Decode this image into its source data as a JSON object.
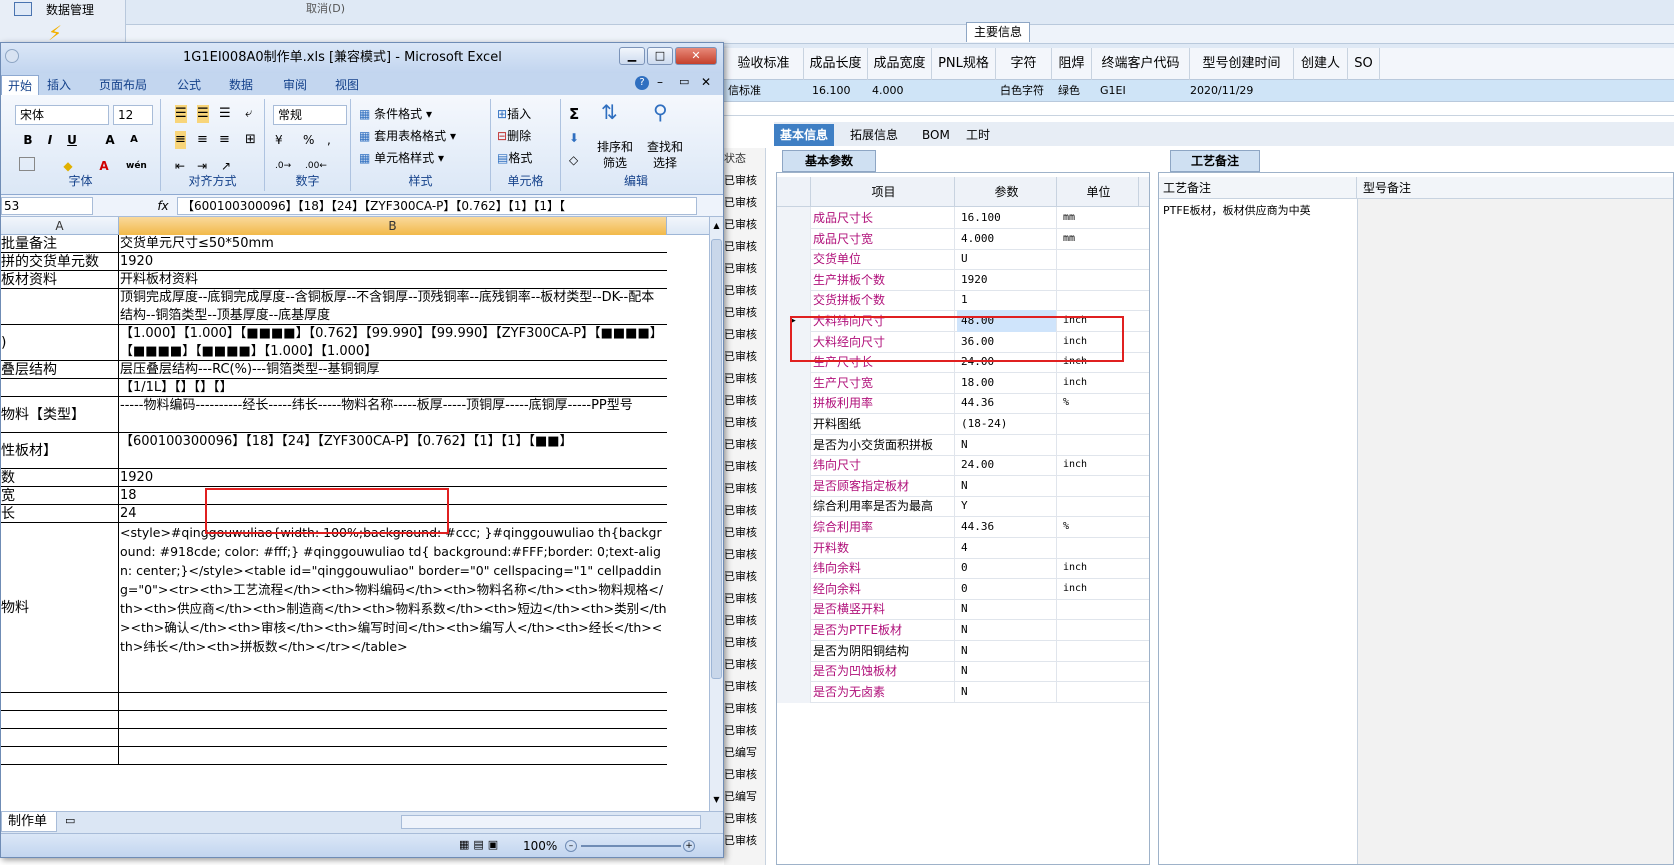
{
  "bg": {
    "nav_item": "数据管理",
    "top_fragment": "取消(D)",
    "main_info_label": "主要信息",
    "grid_headers": [
      "验收标准",
      "成品长度",
      "成品宽度",
      "PNL规格",
      "字符",
      "阻焊",
      "终端客户代码",
      "型号创建时间",
      "创建人",
      "SO"
    ],
    "grid_row": {
      "standard": "信标准",
      "length": "16.100",
      "width": "4.000",
      "char": "白色字符",
      "mask": "绿色",
      "customer": "G1EI",
      "created": "2020/11/29"
    },
    "status_header": "状态",
    "status_cells": [
      "已审核",
      "已审核",
      "已审核",
      "已审核",
      "已审核",
      "已审核",
      "已审核",
      "已审核",
      "已审核",
      "已审核",
      "已审核",
      "已审核",
      "已审核",
      "已审核",
      "已审核",
      "已审核",
      "已审核",
      "已审核",
      "已审核",
      "已审核",
      "已审核",
      "已审核",
      "已审核",
      "已审核",
      "已审核",
      "已审核",
      "已编写",
      "已审核",
      "已编写",
      "已审核",
      "已审核"
    ],
    "tabs": [
      "基本信息",
      "拓展信息",
      "BOM",
      "工时"
    ],
    "subtab_params": "基本参数",
    "subtab_notes": "工艺备注",
    "param_headers": {
      "item": "项目",
      "param": "参数",
      "unit": "单位"
    },
    "params": [
      {
        "name": "成品尺寸长",
        "value": "16.100",
        "unit": "mm",
        "magenta": true
      },
      {
        "name": "成品尺寸宽",
        "value": "4.000",
        "unit": "mm",
        "magenta": true
      },
      {
        "name": "交货单位",
        "value": "U",
        "unit": "",
        "magenta": true
      },
      {
        "name": "生产拼板个数",
        "value": "1920",
        "unit": "",
        "magenta": true
      },
      {
        "name": "交货拼板个数",
        "value": "1",
        "unit": "",
        "magenta": true
      },
      {
        "name": "大料纬向尺寸",
        "value": "48.00",
        "unit": "inch",
        "magenta": true
      },
      {
        "name": "大料经向尺寸",
        "value": "36.00",
        "unit": "inch",
        "magenta": true
      },
      {
        "name": "生产尺寸长",
        "value": "24.00",
        "unit": "inch",
        "magenta": true
      },
      {
        "name": "生产尺寸宽",
        "value": "18.00",
        "unit": "inch",
        "magenta": true
      },
      {
        "name": "拼板利用率",
        "value": "44.36",
        "unit": "%",
        "magenta": true
      },
      {
        "name": "开料图纸",
        "value": "(18-24)",
        "unit": "",
        "magenta": false
      },
      {
        "name": "是否为小交货面积拼板",
        "value": "N",
        "unit": "",
        "magenta": false
      },
      {
        "name": "纬向尺寸",
        "value": "24.00",
        "unit": "inch",
        "magenta": true
      },
      {
        "name": "是否顾客指定板材",
        "value": "N",
        "unit": "",
        "magenta": true
      },
      {
        "name": "综合利用率是否为最高",
        "value": "Y",
        "unit": "",
        "magenta": false
      },
      {
        "name": "综合利用率",
        "value": "44.36",
        "unit": "%",
        "magenta": true
      },
      {
        "name": "开料数",
        "value": "4",
        "unit": "",
        "magenta": true
      },
      {
        "name": "纬向余料",
        "value": "0",
        "unit": "inch",
        "magenta": true
      },
      {
        "name": "经向余料",
        "value": "0",
        "unit": "inch",
        "magenta": true
      },
      {
        "name": "是否横竖开料",
        "value": "N",
        "unit": "",
        "magenta": true
      },
      {
        "name": "是否为PTFE板材",
        "value": "N",
        "unit": "",
        "magenta": true
      },
      {
        "name": "是否为阴阳铜结构",
        "value": "N",
        "unit": "",
        "magenta": false
      },
      {
        "name": "是否为凹蚀板材",
        "value": "N",
        "unit": "",
        "magenta": true
      },
      {
        "name": "是否为无卤素",
        "value": "N",
        "unit": "",
        "magenta": true
      }
    ],
    "notes_headers": {
      "process": "工艺备注",
      "model": "型号备注"
    },
    "process_note": "PTFE板材，板材供应商为中英",
    "colors": {
      "magenta": "#b0107a",
      "tab_active": "#3f7fc4",
      "highlight_red": "#e02020"
    }
  },
  "excel": {
    "title": "1G1EI008A0制作单.xls [兼容模式] - Microsoft Excel",
    "ribbon_tabs": [
      "开始",
      "插入",
      "页面布局",
      "公式",
      "数据",
      "审阅",
      "视图"
    ],
    "font_name": "宋体",
    "font_size": "12",
    "number_format": "常规",
    "groups": {
      "font": "字体",
      "align": "对齐方式",
      "number": "数字",
      "style": "样式",
      "cells": "单元格",
      "edit": "编辑"
    },
    "style_items": [
      "条件格式",
      "套用表格格式",
      "单元格样式"
    ],
    "cell_items": [
      "插入",
      "删除",
      "格式"
    ],
    "edit_items": [
      "排序和筛选",
      "查找和选择"
    ],
    "name_box": "53",
    "formula": "【600100300096】【18】【24】【ZYF300CA-P】【0.762】【1】【1】【",
    "col_a": "A",
    "col_b": "B",
    "rows": [
      {
        "a": "批量备注",
        "b": "交货单元尺寸≤50*50mm"
      },
      {
        "a": "拼的交货单元数",
        "b": "1920"
      },
      {
        "a": "板材资料",
        "b": "开料板材资料"
      },
      {
        "a": "",
        "b": "顶铜完成厚度--底铜完成厚度--含铜板厚--不含铜厚--顶残铜率--底残铜率--板材类型--DK--配本结构--铜箔类型--顶基厚度--底基厚度"
      },
      {
        "a": ")",
        "b": "【1.000】【1.000】【■■■■】【0.762】【99.990】【99.990】【ZYF300CA-P】【■■■■】【■■■■】【■■■■】【1.000】【1.000】"
      },
      {
        "a": "叠层结构",
        "b": "层压叠层结构---RC(%)---铜箔类型--基铜铜厚"
      },
      {
        "a": "",
        "b": "【1/1L】【】【】【】"
      },
      {
        "a": "物料【类型】",
        "b": "-----物料编码----------经长-----纬长-----物料名称-----板厚-----顶铜厚-----底铜厚-----PP型号"
      },
      {
        "a": "性板材】",
        "b": "【600100300096】【18】【24】【ZYF300CA-P】【0.762】【1】【1】【■■】"
      },
      {
        "a": "数",
        "b": "1920"
      },
      {
        "a": "宽",
        "b": "18"
      },
      {
        "a": "长",
        "b": "24"
      },
      {
        "a": "物料",
        "b": "<style>#qinggouwuliao{width: 100%;background: #ccc; }#qinggouwuliao th{background: #918cde; color: #fff;} #qinggouwuliao td{ background:#FFF;border: 0;text-align: center;}</style><table id=\"qinggouwuliao\" border=\"0\" cellspacing=\"1\" cellpadding=\"0\"><tr><th>工艺流程</th><th>物料编码</th><th>物料名称</th><th>物料规格</th><th>供应商</th><th>制造商</th><th>物料系数</th><th>短边</th><th>类别</th><th>确认</th><th>审核</th><th>编写时间</th><th>编写人</th><th>经长</th><th>纬长</th><th>拼板数</th></tr></table>"
      },
      {
        "a": "",
        "b": ""
      },
      {
        "a": "",
        "b": ""
      },
      {
        "a": "",
        "b": ""
      },
      {
        "a": "",
        "b": ""
      }
    ],
    "sheet_tab": "制作单",
    "zoom": "100%"
  }
}
